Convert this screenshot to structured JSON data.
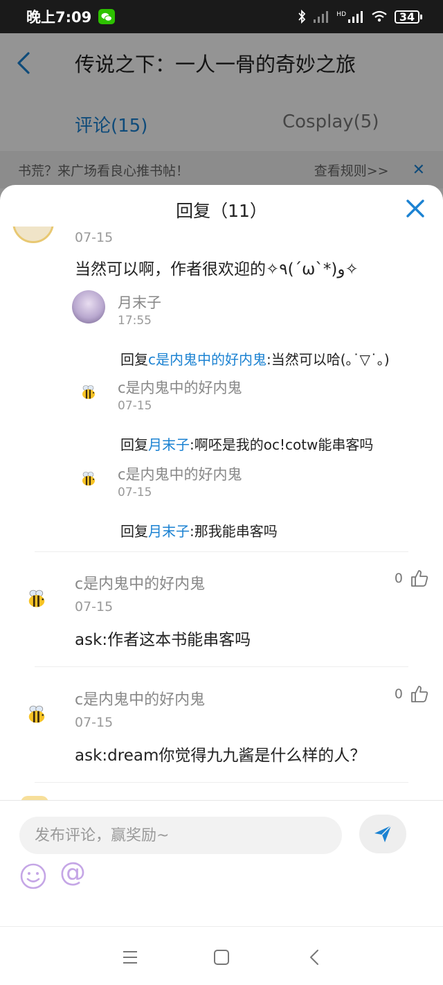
{
  "status_bar": {
    "time": "晚上7:09",
    "network": "HD",
    "battery": "34"
  },
  "background": {
    "title": "传说之下：一人一骨的奇妙之旅",
    "tabs": [
      {
        "label": "评论(15)",
        "active": true
      },
      {
        "label": "Cosplay(5)",
        "active": false
      }
    ],
    "notice": "书荒？来广场看良心推书帖！",
    "notice_link": "查看规则>>"
  },
  "sheet": {
    "title": "回复（11）",
    "top": {
      "date": "07-15",
      "text": "当然可以啊，作者很欢迎的✧٩(ˊωˋ*)و✧"
    },
    "replies": [
      {
        "name": "月末子",
        "date": "17:55",
        "prefix": "回复",
        "mention": "c是内鬼中的好内鬼",
        "text": ":当然可以哈(｡˙▽˙｡)"
      },
      {
        "name": "c是内鬼中的好内鬼",
        "date": "07-15",
        "prefix": "回复",
        "mention": "月末子",
        "text": ":啊呸是我的oc!cotw能串客吗"
      },
      {
        "name": "c是内鬼中的好内鬼",
        "date": "07-15",
        "prefix": "回复",
        "mention": "月末子",
        "text": ":那我能串客吗"
      }
    ],
    "comments": [
      {
        "name": "c是内鬼中的好内鬼",
        "date": "07-15",
        "text": "ask:作者这本书能串客吗",
        "likes": "0"
      },
      {
        "name": "c是内鬼中的好内鬼",
        "date": "07-15",
        "text": "ask:dream你觉得九九酱是什么样的人？",
        "likes": "0"
      }
    ]
  },
  "input": {
    "placeholder": "发布评论，赢奖励~",
    "at_symbol": "@"
  },
  "colors": {
    "accent": "#1b82d2",
    "mention": "#1b82d2",
    "emoji_purple": "#c5a6e6"
  }
}
